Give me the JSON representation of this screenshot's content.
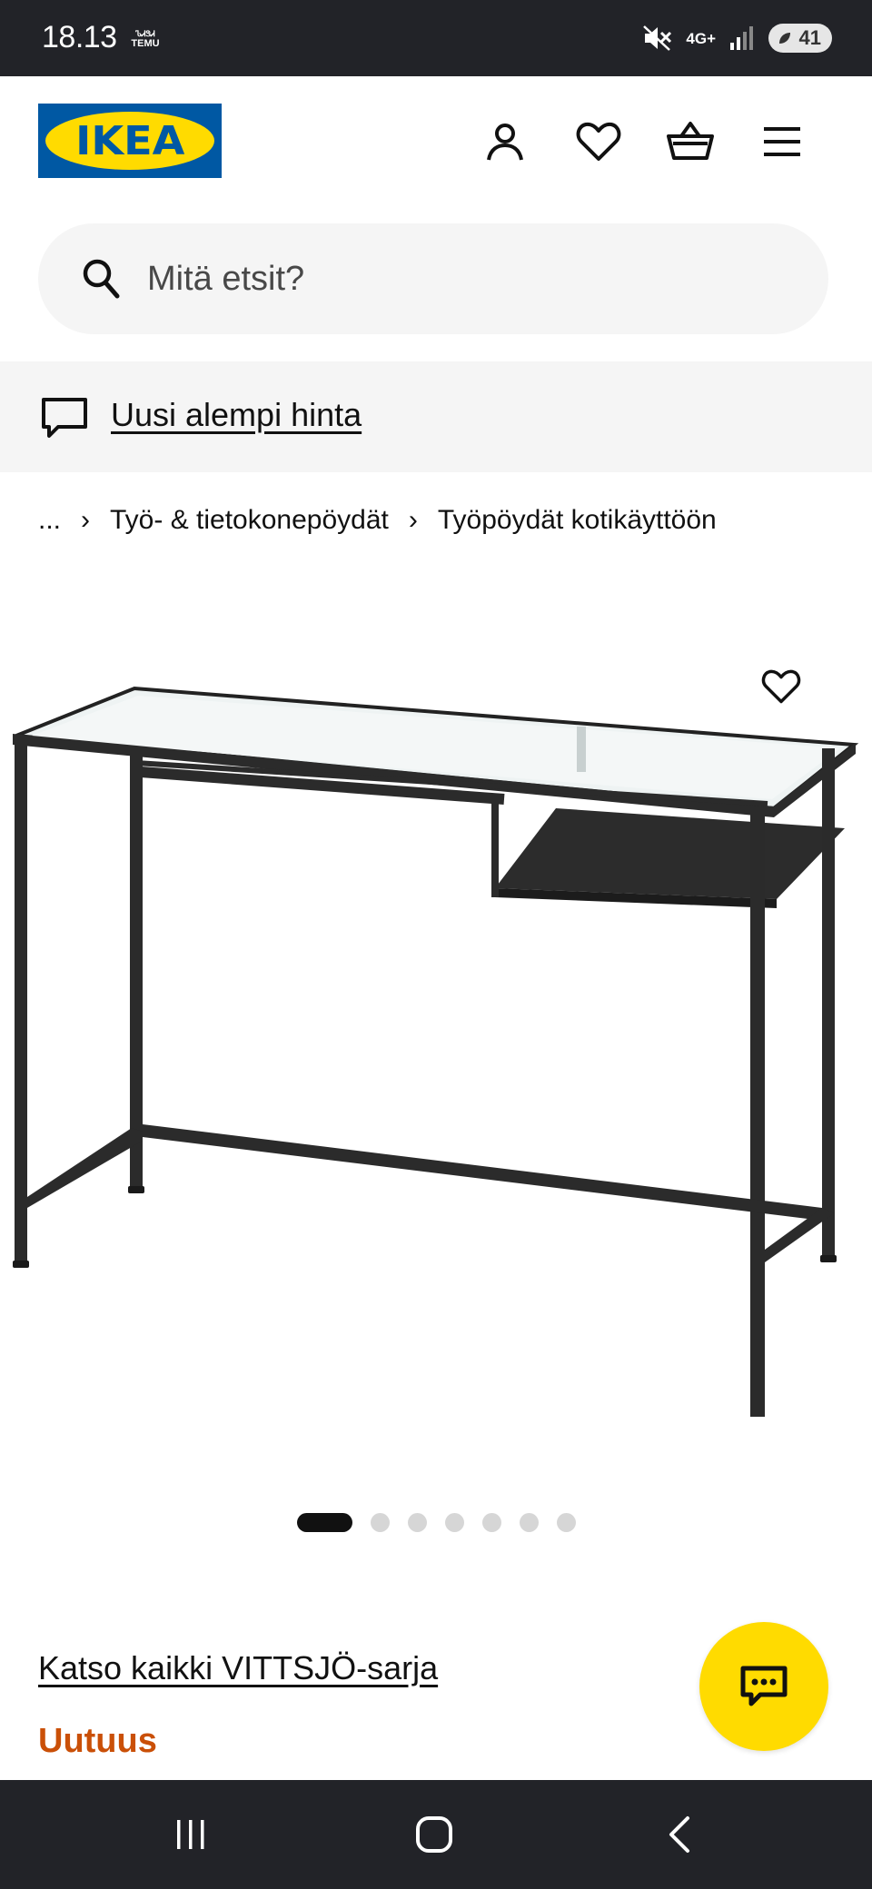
{
  "status_bar": {
    "time": "18.13",
    "temu_top": "ᏖᏗᏕᏗ",
    "temu_bottom": "TEMU",
    "network": "4G+",
    "battery": "41"
  },
  "header": {
    "logo_text": "IKEA",
    "icons": [
      "account-icon",
      "heart-icon",
      "basket-icon",
      "menu-icon"
    ]
  },
  "search": {
    "placeholder": "Mitä etsit?"
  },
  "banner": {
    "link": "Uusi alempi hinta"
  },
  "breadcrumb": {
    "ellipsis": "...",
    "items": [
      "Työ- & tietokonepöydät",
      "Työpöydät kotikäyttöön"
    ]
  },
  "gallery": {
    "image_count": 7,
    "active_index": 0
  },
  "product": {
    "series_link": "Katso kaikki VITTSJÖ-sarja",
    "badge": "Uutuus"
  },
  "colors": {
    "ikea_blue": "#0058a3",
    "ikea_yellow": "#ffdb00",
    "new_orange": "#ca5008"
  }
}
